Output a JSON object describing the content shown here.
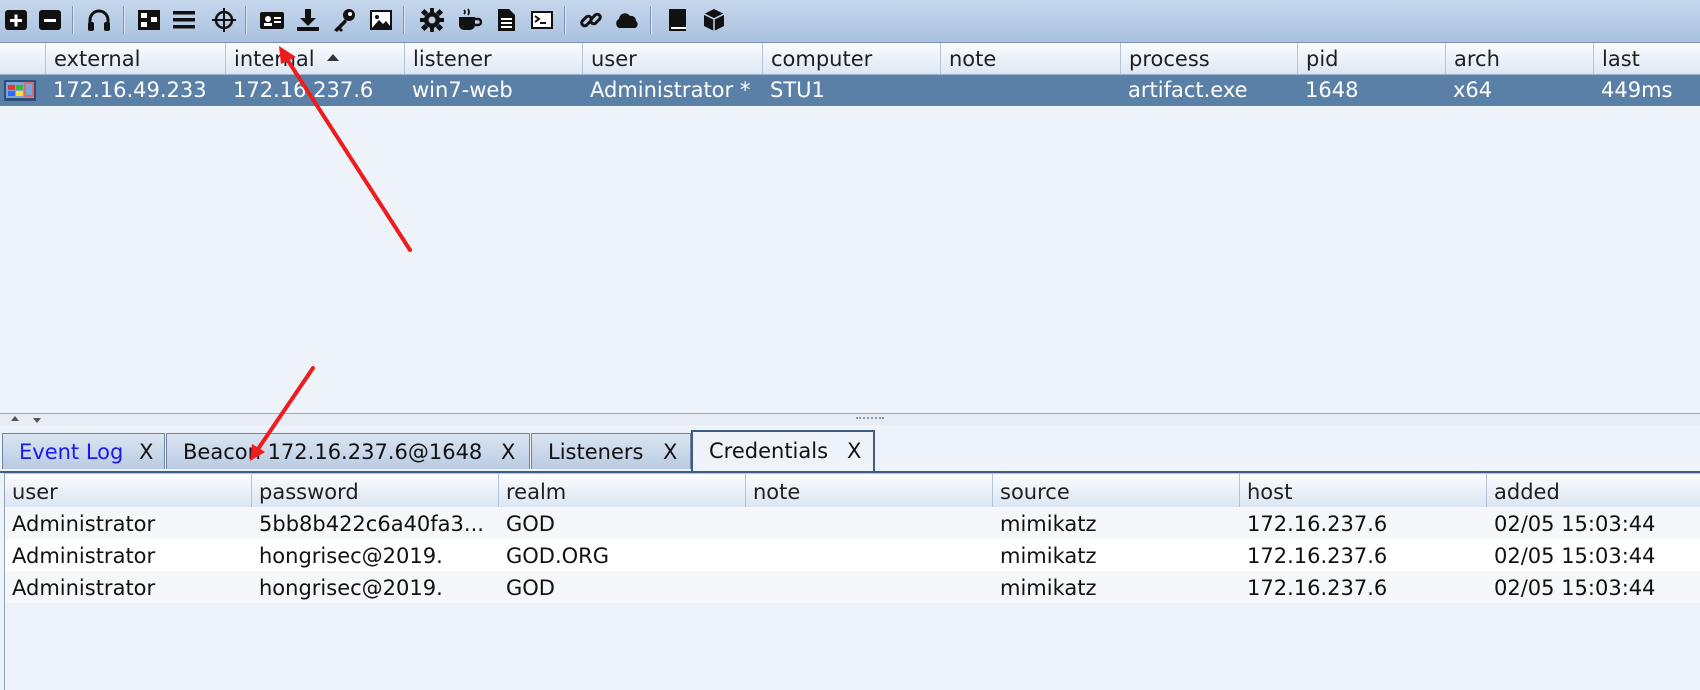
{
  "toolbar": {
    "icons": [
      "plus-icon",
      "minus-icon",
      "headphones-icon",
      "pivot-graph-icon",
      "list-icon",
      "crosshair-icon",
      "id-card-icon",
      "download-icon",
      "key-icon",
      "image-icon",
      "gear-icon",
      "coffee-cup-icon",
      "document-icon",
      "terminal-icon",
      "link-icon",
      "cloud-icon",
      "book-icon",
      "cube-icon"
    ]
  },
  "beacons": {
    "columns": [
      "external",
      "internal",
      "listener",
      "user",
      "computer",
      "note",
      "process",
      "pid",
      "arch",
      "last"
    ],
    "sorted_column": "internal",
    "rows": [
      {
        "external": "172.16.49.233",
        "internal": "172.16.237.6",
        "listener": "win7-web",
        "user": "Administrator *",
        "computer": "STU1",
        "note": "",
        "process": "artifact.exe",
        "pid": "1648",
        "arch": "x64",
        "last": "449ms"
      }
    ]
  },
  "tabs": [
    {
      "label": "Event Log",
      "close": "X",
      "active": false,
      "highlight": true
    },
    {
      "label": "Beacon 172.16.237.6@1648",
      "close": "X",
      "active": false,
      "highlight": false
    },
    {
      "label": "Listeners",
      "close": "X",
      "active": false,
      "highlight": false
    },
    {
      "label": "Credentials",
      "close": "X",
      "active": true,
      "highlight": false
    }
  ],
  "credentials": {
    "columns": [
      "user",
      "password",
      "realm",
      "note",
      "source",
      "host",
      "added"
    ],
    "rows": [
      {
        "user": "Administrator",
        "password": "5bb8b422c6a40fa3...",
        "realm": "GOD",
        "note": "",
        "source": "mimikatz",
        "host": "172.16.237.6",
        "added": "02/05 15:03:44"
      },
      {
        "user": "Administrator",
        "password": "hongrisec@2019.",
        "realm": "GOD.ORG",
        "note": "",
        "source": "mimikatz",
        "host": "172.16.237.6",
        "added": "02/05 15:03:44"
      },
      {
        "user": "Administrator",
        "password": "hongrisec@2019.",
        "realm": "GOD",
        "note": "",
        "source": "mimikatz",
        "host": "172.16.237.6",
        "added": "02/05 15:03:44"
      }
    ]
  },
  "colors": {
    "selected_row": "#5a80a8",
    "annotation": "#ee1c1c",
    "tab_highlight": "#1a1aef"
  }
}
